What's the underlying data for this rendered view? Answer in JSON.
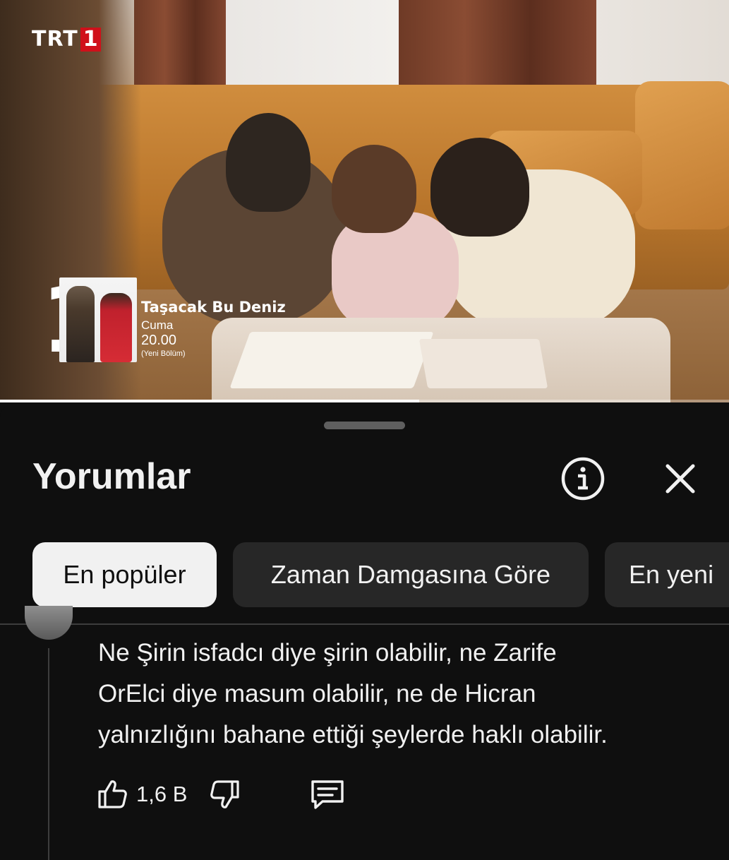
{
  "video": {
    "channel_logo_text": "TRT",
    "channel_logo_number": "1",
    "progress_fraction": 0.575,
    "promo": {
      "big_number": "1",
      "title": "Taşacak Bu Deniz",
      "day": "Cuma",
      "time": "20.00",
      "note": "(Yeni Bölüm)"
    }
  },
  "comments_panel": {
    "title": "Yorumlar",
    "info_icon": "info-circle-icon",
    "close_icon": "close-icon",
    "sort_chips": [
      {
        "label": "En popüler",
        "active": true
      },
      {
        "label": "Zaman Damgasına Göre",
        "active": false
      },
      {
        "label": "En yeni",
        "active": false
      }
    ],
    "comment": {
      "lines": [
        "Ne Şirin isfadcı diye şirin olabilir, ne Zarife",
        "OrElci diye masum olabilir, ne de Hicran",
        "yalnızlığını bahane ettiği şeylerde haklı olabilir."
      ],
      "like_count": "1,6 B",
      "like_icon": "thumbs-up-icon",
      "dislike_icon": "thumbs-down-icon",
      "reply_icon": "reply-comment-icon"
    }
  },
  "colors": {
    "background": "#0f0f0f",
    "chip_active_bg": "#f1f1f1",
    "chip_inactive_bg": "#272727",
    "trt_red": "#d0101a"
  }
}
